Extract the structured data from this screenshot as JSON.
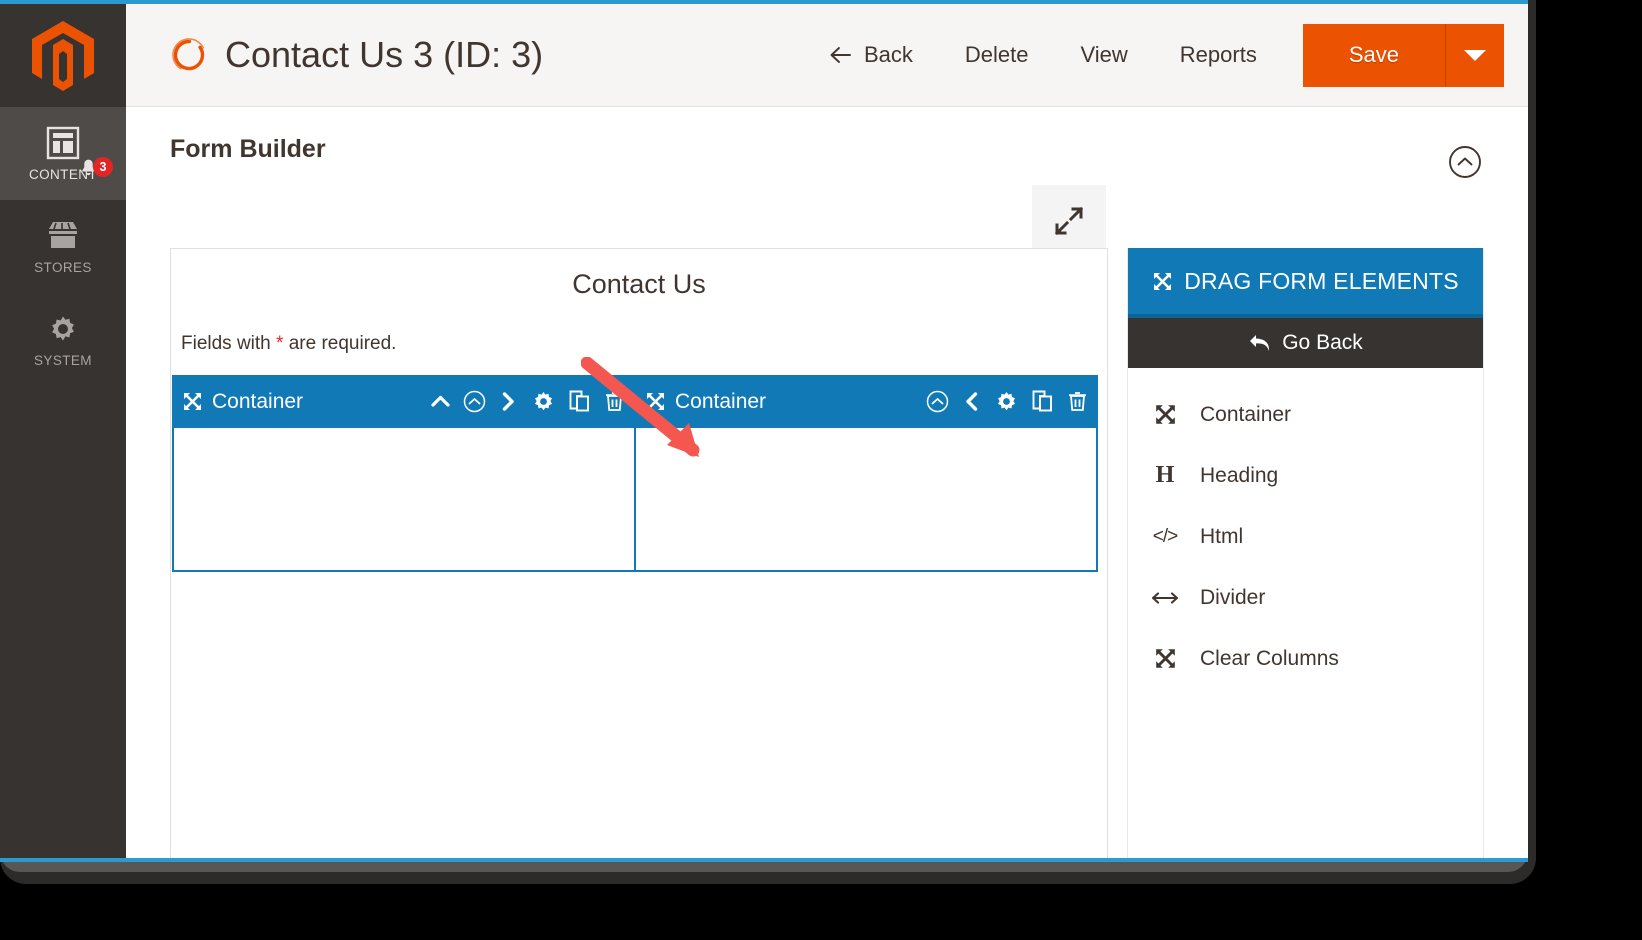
{
  "sidebar": {
    "logo_icon": "magento-logo-icon",
    "items": [
      {
        "label": "CONTENT",
        "icon": "content-layout-icon",
        "active": true,
        "badge": "3"
      },
      {
        "label": "STORES",
        "icon": "store-icon",
        "active": false,
        "badge": ""
      },
      {
        "label": "SYSTEM",
        "icon": "gear-icon",
        "active": false,
        "badge": ""
      }
    ]
  },
  "header": {
    "spinner_icon": "loading-spinner-icon",
    "title": "Contact Us 3 (ID: 3)",
    "actions": [
      {
        "label": "Back",
        "icon": "arrow-left-icon"
      },
      {
        "label": "Delete",
        "icon": ""
      },
      {
        "label": "View",
        "icon": ""
      },
      {
        "label": "Reports",
        "icon": ""
      }
    ],
    "save_label": "Save",
    "save_caret_icon": "caret-down-icon",
    "accent_color": "#eb5202"
  },
  "section": {
    "title": "Form Builder",
    "collapse_icon": "circle-chevron-up-icon",
    "fullscreen_icon": "expand-diagonal-icon"
  },
  "canvas": {
    "form_heading": "Contact Us",
    "required_note_prefix": "Fields with ",
    "required_note_star": "*",
    "required_note_suffix": " are required.",
    "containers": [
      {
        "label": "Container",
        "move_icon": "move-arrows-icon",
        "tools": [
          "chevron-up-icon",
          "circle-chevron-up-icon",
          "chevron-right-icon",
          "gear-icon",
          "copy-icon",
          "trash-icon"
        ]
      },
      {
        "label": "Container",
        "move_icon": "move-arrows-icon",
        "tools": [
          "circle-chevron-up-icon",
          "chevron-left-icon",
          "gear-icon",
          "copy-icon",
          "trash-icon"
        ]
      }
    ]
  },
  "elements_panel": {
    "header_label": "DRAG FORM ELEMENTS",
    "header_icon": "move-arrows-icon",
    "header_color": "#1179b5",
    "go_back_label": "Go Back",
    "go_back_icon": "arrow-back-curved-icon",
    "items": [
      {
        "label": "Container",
        "icon": "move-arrows-icon"
      },
      {
        "label": "Heading",
        "icon": "heading-h-icon"
      },
      {
        "label": "Html",
        "icon": "code-tags-icon"
      },
      {
        "label": "Divider",
        "icon": "arrows-horizontal-icon"
      },
      {
        "label": "Clear Columns",
        "icon": "move-arrows-icon"
      }
    ]
  },
  "annotation": {
    "arrow_icon": "red-pointer-arrow-icon",
    "color": "#f4574f"
  }
}
